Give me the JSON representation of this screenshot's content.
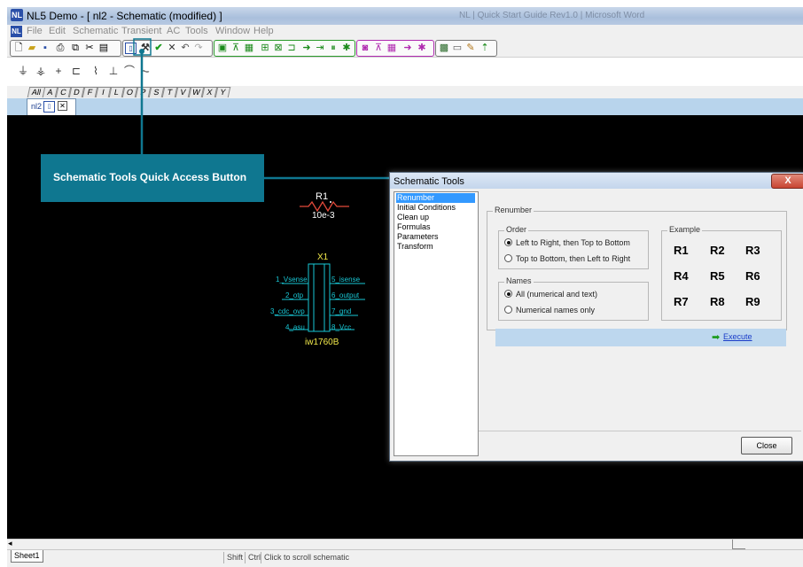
{
  "window": {
    "title": "NL5 Demo - [ nl2 - Schematic (modified) ]",
    "background_title": "NL | Quick Start Guide Rev1.0 | Microsoft Word",
    "app_icon_text": "NL"
  },
  "menu": {
    "icon_text": "NL",
    "items": [
      "File",
      "Edit",
      "Schematic",
      "Transient",
      "AC",
      "Tools",
      "Window",
      "Help"
    ]
  },
  "letter_tabs": [
    "All",
    "A",
    "C",
    "D",
    "F",
    "I",
    "L",
    "O",
    "P",
    "S",
    "T",
    "V",
    "W",
    "X",
    "Y"
  ],
  "document_tab": {
    "label": "nl2",
    "close": "✕"
  },
  "callout": {
    "text": "Schematic Tools Quick Access Button"
  },
  "schematic": {
    "r1_name": "R1",
    "r1_value": "10e-3",
    "x1_name": "X1",
    "x1_part": "iw1760B",
    "x1_left_pins": [
      "1_Vsense",
      "2_otp",
      "3_cdc_ovp",
      "4_asu"
    ],
    "x1_right_pins": [
      "5_isense",
      "6_output",
      "7_gnd",
      "8_Vcc"
    ]
  },
  "dialog": {
    "title": "Schematic Tools",
    "close_glyph": "X",
    "nav": [
      "Renumber",
      "Initial Conditions",
      "Clean up",
      "Formulas",
      "Parameters",
      "Transform"
    ],
    "selected_nav": "Renumber",
    "renumber_legend": "Renumber",
    "order_legend": "Order",
    "order_options": [
      "Left to Right, then Top to Bottom",
      "Top to Bottom, then Left to Right"
    ],
    "order_selected": 0,
    "names_legend": "Names",
    "names_options": [
      "All (numerical and text)",
      "Numerical names only"
    ],
    "names_selected": 0,
    "example_legend": "Example",
    "example": [
      [
        "R1",
        "R2",
        "R3"
      ],
      [
        "R4",
        "R5",
        "R6"
      ],
      [
        "R7",
        "R8",
        "R9"
      ]
    ],
    "execute_label": "Execute",
    "close_button": "Close"
  },
  "status": {
    "sheet_tab": "Sheet1",
    "shift": "Shift",
    "ctrl": "Ctrl",
    "message": "Click to scroll schematic"
  },
  "colors": {
    "canvas": "#000000",
    "callout": "#0f7790",
    "pins": "#19c8d6",
    "part_label": "#f2e94a",
    "nav_selected": "#3399ff"
  }
}
